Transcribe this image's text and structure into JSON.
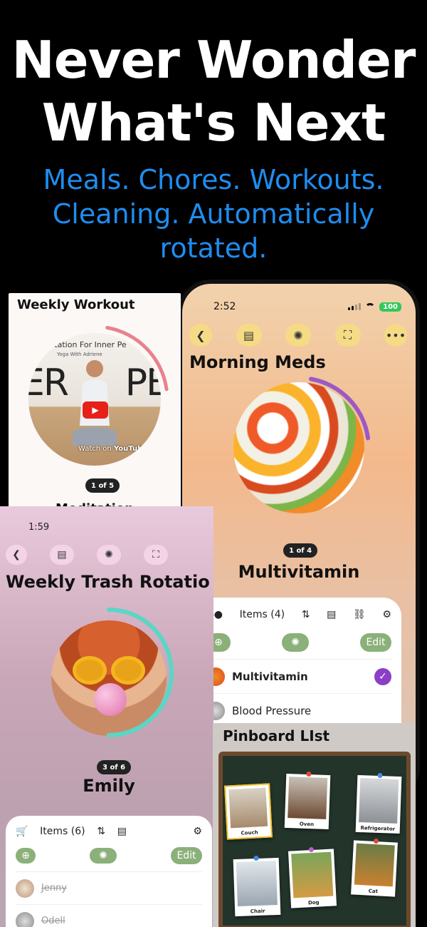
{
  "hero": {
    "headline_line1": "Never Wonder",
    "headline_line2": "What's Next",
    "subhead": "Meals. Chores. Workouts. Cleaning. Automatically rotated."
  },
  "phone_right": {
    "time": "2:52",
    "battery": "100",
    "title": "Morning Meds",
    "counter": "1 of 4",
    "item_name": "Multivitamin",
    "panel": {
      "items_label": "Items (4)",
      "edit_label": "Edit",
      "rows": [
        {
          "name": "Multivitamin",
          "checked": true
        },
        {
          "name": "Blood Pressure",
          "checked": false
        }
      ]
    },
    "progress_ring_fraction": 0.2
  },
  "card_workout": {
    "title": "Weekly Workout",
    "video_title": "Meditation For Inner Pe",
    "video_subtitle": "Yoga With Adriene",
    "video_big_left": "ER",
    "video_big_right": "PE",
    "watch_on": "Watch on",
    "youtube": "YouTube",
    "counter": "1 of 5",
    "item_name": "Meditation",
    "progress_ring_fraction": 0.2
  },
  "phone_left": {
    "time": "1:59",
    "title": "Weekly Trash Rotatio",
    "counter": "3 of 6",
    "item_name": "Emily",
    "panel": {
      "items_label": "Items (6)",
      "edit_label": "Edit",
      "rows": [
        "Jenny",
        "Odell"
      ]
    },
    "progress_ring_fraction": 0.5
  },
  "card_pinboard": {
    "title": "Pinboard LIst",
    "pins": [
      "Couch",
      "Oven",
      "Refrigerator",
      "Chair",
      "Dog",
      "Cat"
    ]
  },
  "colors": {
    "accent_blue": "#1e8df0",
    "toolbar_yellow": "#f6db86",
    "edit_green": "#8bb07a",
    "check_purple": "#8a3fc6",
    "ring_purple": "#9b59c6",
    "ring_red": "#e8828c",
    "ring_teal": "#5ad6c4"
  }
}
